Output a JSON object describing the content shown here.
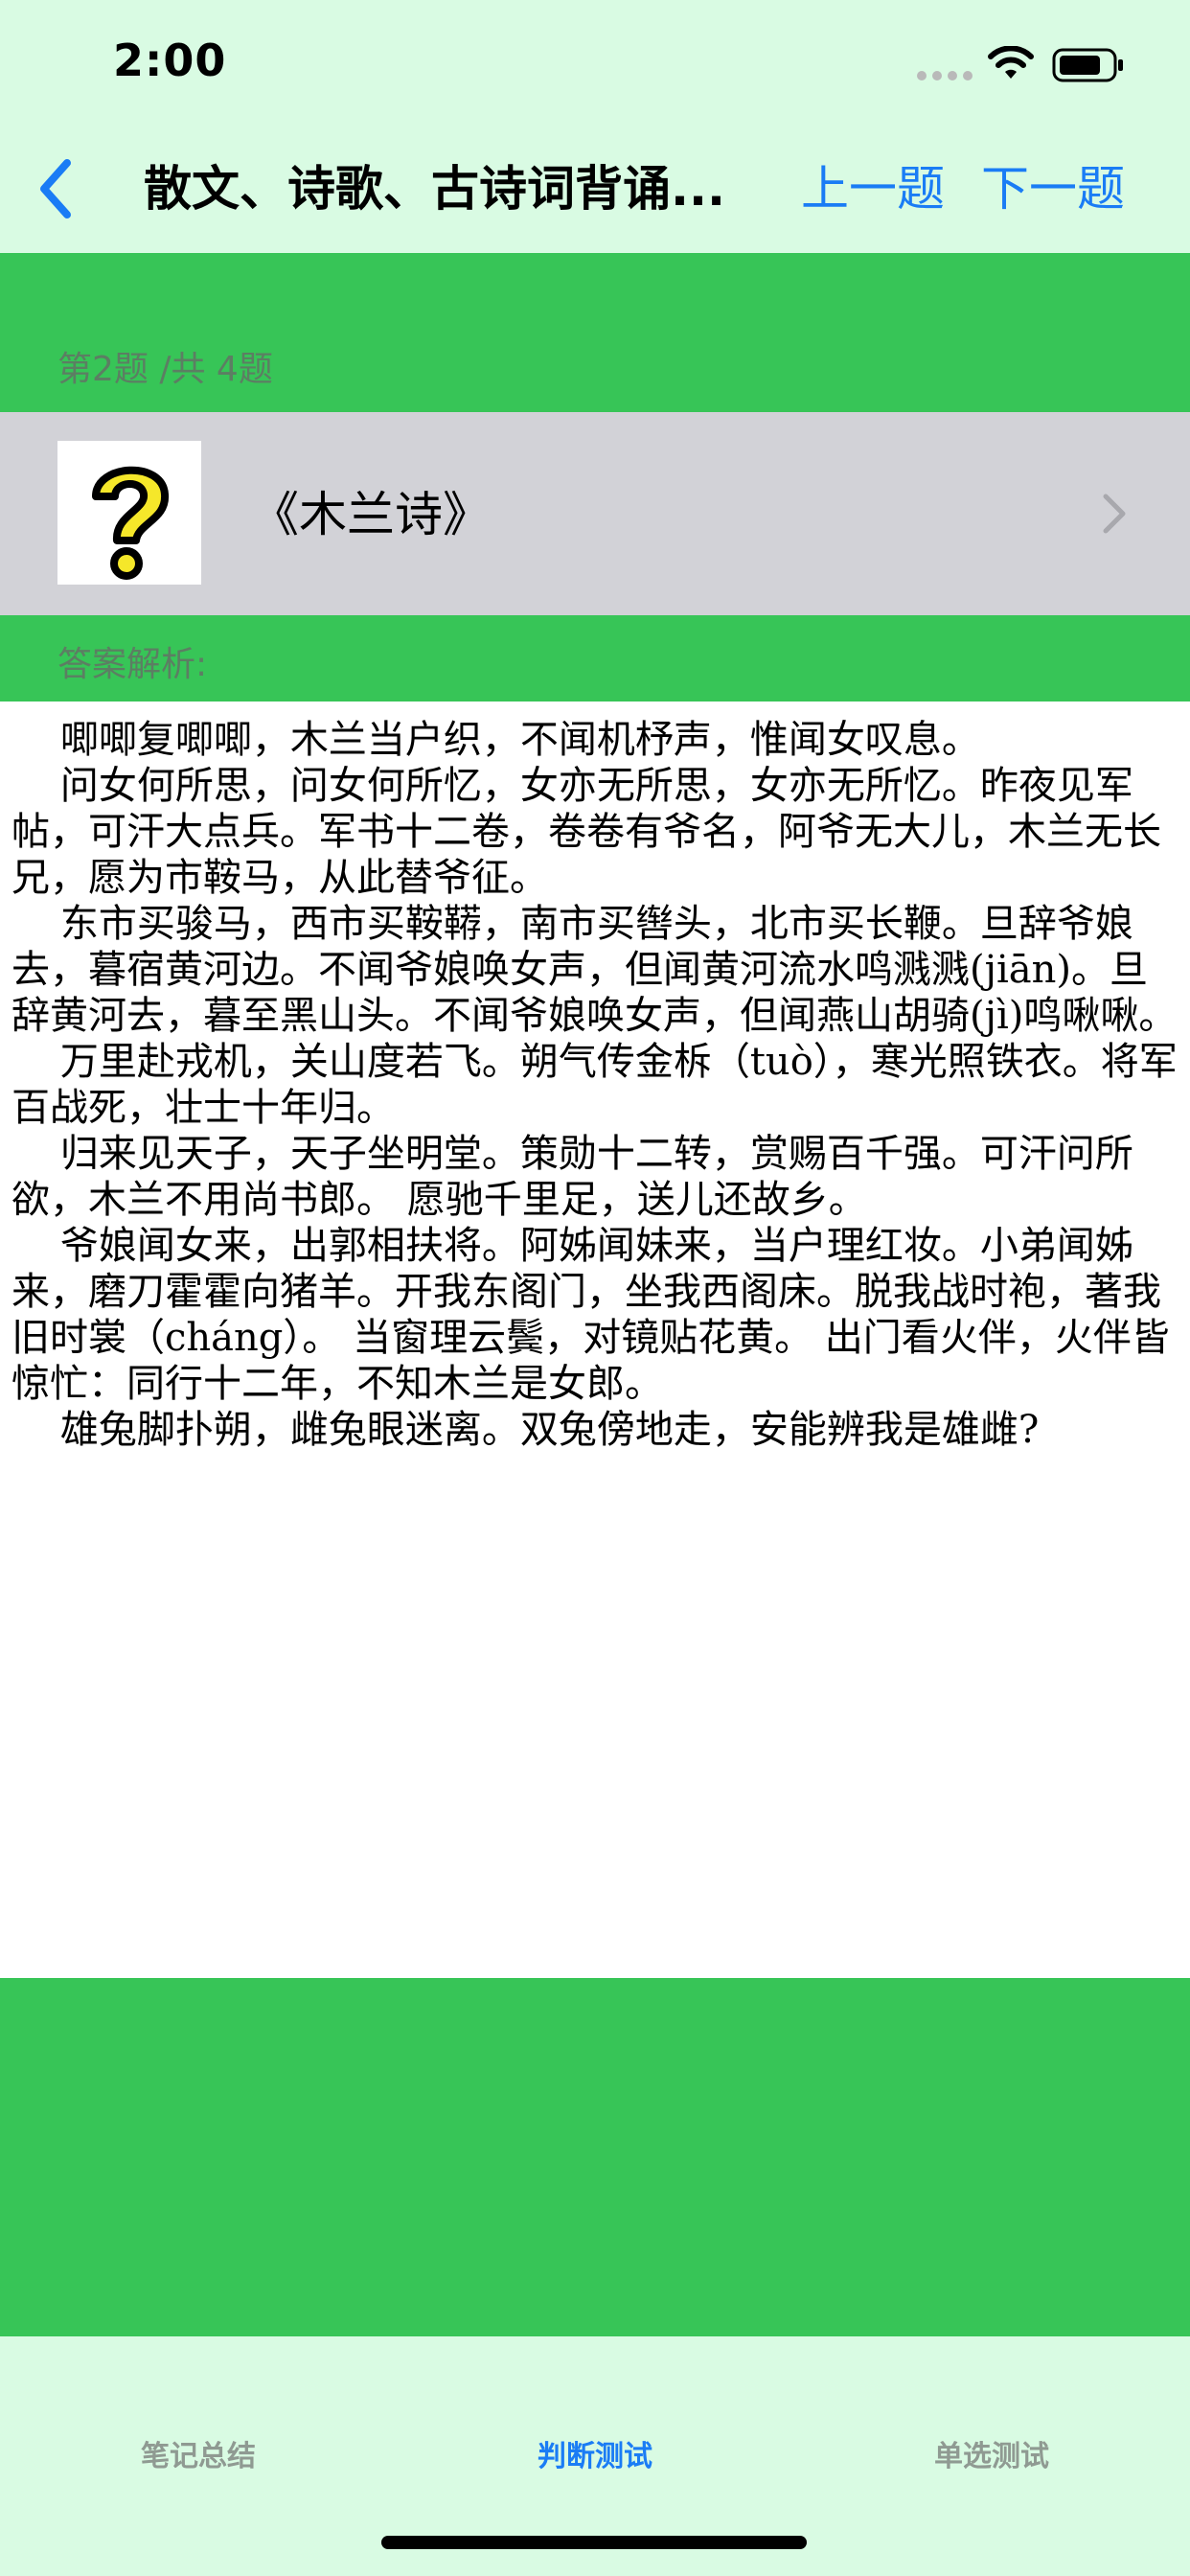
{
  "status_bar": {
    "time": "2:00"
  },
  "nav": {
    "title": "散文、诗歌、古诗词背诵...",
    "prev_label": "上一题",
    "next_label": "下一题"
  },
  "question": {
    "counter": "第2题 /共 4题",
    "title": "《木兰诗》",
    "image_icon": "question-mark-icon"
  },
  "answer": {
    "label": "答案解析:",
    "text": "    唧唧复唧唧，木兰当户织，不闻机杼声，惟闻女叹息。\n    问女何所思，问女何所忆，女亦无所思，女亦无所忆。昨夜见军帖，可汗大点兵。军书十二卷，卷卷有爷名，阿爷无大儿，木兰无长兄，愿为市鞍马，从此替爷征。\n    东市买骏马，西市买鞍鞯，南市买辔头，北市买长鞭。旦辞爷娘去，暮宿黄河边。不闻爷娘唤女声，但闻黄河流水鸣溅溅(jiān)。旦辞黄河去，暮至黑山头。不闻爷娘唤女声，但闻燕山胡骑(jì)鸣啾啾。\n    万里赴戎机，关山度若飞。朔气传金柝（tuò），寒光照铁衣。将军百战死，壮士十年归。\n    归来见天子，天子坐明堂。策勋十二转，赏赐百千强。可汗问所欲，木兰不用尚书郎。 愿驰千里足，送儿还故乡。\n    爷娘闻女来，出郭相扶将。阿姊闻妹来，当户理红妆。小弟闻姊来，磨刀霍霍向猪羊。开我东阁门，坐我西阁床。脱我战时袍，著我旧时裳（cháng）。 当窗理云鬓，对镜贴花黄。 出门看火伴，火伴皆惊忙：同行十二年，不知木兰是女郎。\n    雄兔脚扑朔，雌兔眼迷离。双兔傍地走，安能辨我是雄雌?"
  },
  "tabs": [
    {
      "label": "笔记总结",
      "active": false
    },
    {
      "label": "判断测试",
      "active": true
    },
    {
      "label": "单选测试",
      "active": false
    }
  ],
  "colors": {
    "accent": "#1a7cf5",
    "band_green": "#37c557",
    "top_bg": "#d9fbe3",
    "row_gray": "#d2d2d7"
  }
}
